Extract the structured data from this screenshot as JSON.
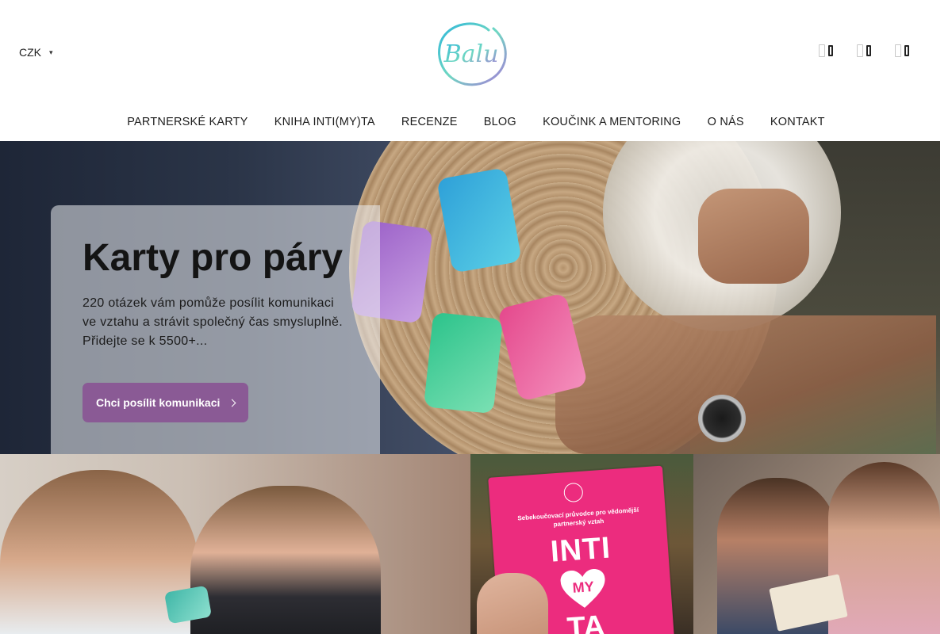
{
  "header": {
    "currency": "CZK",
    "logo_text": "Balu"
  },
  "nav": {
    "items": [
      "PARTNERSKÉ KARTY",
      "KNIHA INTI(MY)TA",
      "RECENZE",
      "BLOG",
      "KOUČINK A MENTORING",
      "O NÁS",
      "KONTAKT"
    ]
  },
  "header_icons": [
    "search-icon",
    "user-icon",
    "cart-icon"
  ],
  "hero": {
    "title": "Karty pro páry",
    "text": "220 otázek vám pomůže posílit komunikaci ve vztahu a strávit společný čas smysluplně. Přidejte se k 5500+...",
    "button_label": "Chci posílit komunikaci",
    "button_color": "#8a5a95"
  },
  "book": {
    "subtitle": "Sebekoučovací průvodce pro vědomější partnerský vztah",
    "title_top": "INTI",
    "title_mid": "MY",
    "title_bottom": "TA"
  }
}
